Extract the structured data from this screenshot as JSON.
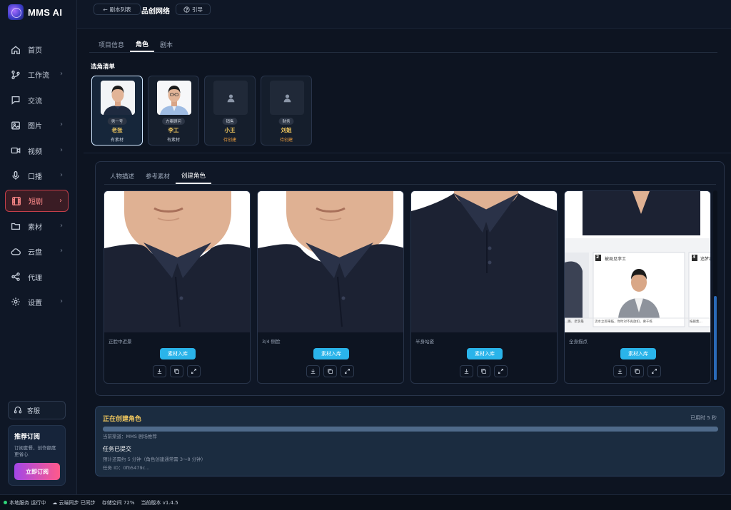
{
  "app": {
    "name": "MMS AI"
  },
  "colors": {
    "accent": "#2ab4ea",
    "active_nav": "#c43f4a",
    "highlight": "#f0c75e",
    "pending": "#e89a3c",
    "background": "#0d1421"
  },
  "sidebar": {
    "items": [
      {
        "label": "首页",
        "icon": "home-icon",
        "chevron": false
      },
      {
        "label": "工作流",
        "icon": "workflow-icon",
        "chevron": true
      },
      {
        "label": "交流",
        "icon": "chat-icon",
        "chevron": false
      },
      {
        "label": "图片",
        "icon": "image-icon",
        "chevron": true
      },
      {
        "label": "视频",
        "icon": "video-icon",
        "chevron": true
      },
      {
        "label": "口播",
        "icon": "microphone-icon",
        "chevron": true
      },
      {
        "label": "短剧",
        "icon": "film-icon",
        "chevron": true,
        "active": true
      },
      {
        "label": "素材",
        "icon": "folder-icon",
        "chevron": true
      },
      {
        "label": "云盘",
        "icon": "cloud-icon",
        "chevron": true
      },
      {
        "label": "代理",
        "icon": "share-icon",
        "chevron": false
      },
      {
        "label": "设置",
        "icon": "gear-icon",
        "chevron": true
      }
    ],
    "support_label": "客服",
    "subscription": {
      "title": "推荐订阅",
      "desc": "订阅套餐，创作额度更省心",
      "button": "立即订阅"
    }
  },
  "header": {
    "back_label": "剧本列表",
    "project_title": "品创网络",
    "guide_label": "引导"
  },
  "tabs": [
    "项目信息",
    "角色",
    "剧本"
  ],
  "active_tab": 1,
  "roles_section_title": "选角清单",
  "roles": [
    {
      "tag": "男一号",
      "name": "老张",
      "status": "有素材",
      "has_image": true
    },
    {
      "tag": "方案顾问",
      "name": "李工",
      "status": "有素材",
      "has_image": true
    },
    {
      "tag": "销售",
      "name": "小王",
      "status": "待创建",
      "has_image": false
    },
    {
      "tag": "财务",
      "name": "刘姐",
      "status": "待创建",
      "has_image": false
    }
  ],
  "panel_tabs": [
    "人物描述",
    "参考素材",
    "创建角色"
  ],
  "active_panel_tab": 2,
  "images": [
    {
      "label": "正脸中近景",
      "button": "素材入库"
    },
    {
      "label": "3/4 侧脸",
      "button": "素材入库"
    },
    {
      "label": "半身站姿",
      "button": "素材入库"
    },
    {
      "label": "全身描点",
      "button": "素材入库"
    }
  ],
  "sheet_strip": {
    "panel_a": "2",
    "panel_a_title": "被局见李工",
    "panel_b": "3",
    "panel_b_title": "追梦者",
    "caption_a": "...路、老李最",
    "caption_b": "流水立即来临，你时对不再放扣，要干练",
    "caption_c": "按剧集..."
  },
  "progress": {
    "title": "正在创建角色",
    "elapsed": "已用时 5 秒",
    "fraction": 1.0,
    "channel": "当前渠道：MMS 剧场推荐",
    "status": "任务已提交",
    "estimate": "预计还需约 5 分钟（角色创建通常需 3～8 分钟）",
    "task_id": "任务 ID：0fb5479c..."
  },
  "statusbar": {
    "service": "本地服务 运行中",
    "sync": "云端同步 已同步",
    "storage": "存储空间 72%",
    "version": "当前版本 v1.4.5"
  }
}
